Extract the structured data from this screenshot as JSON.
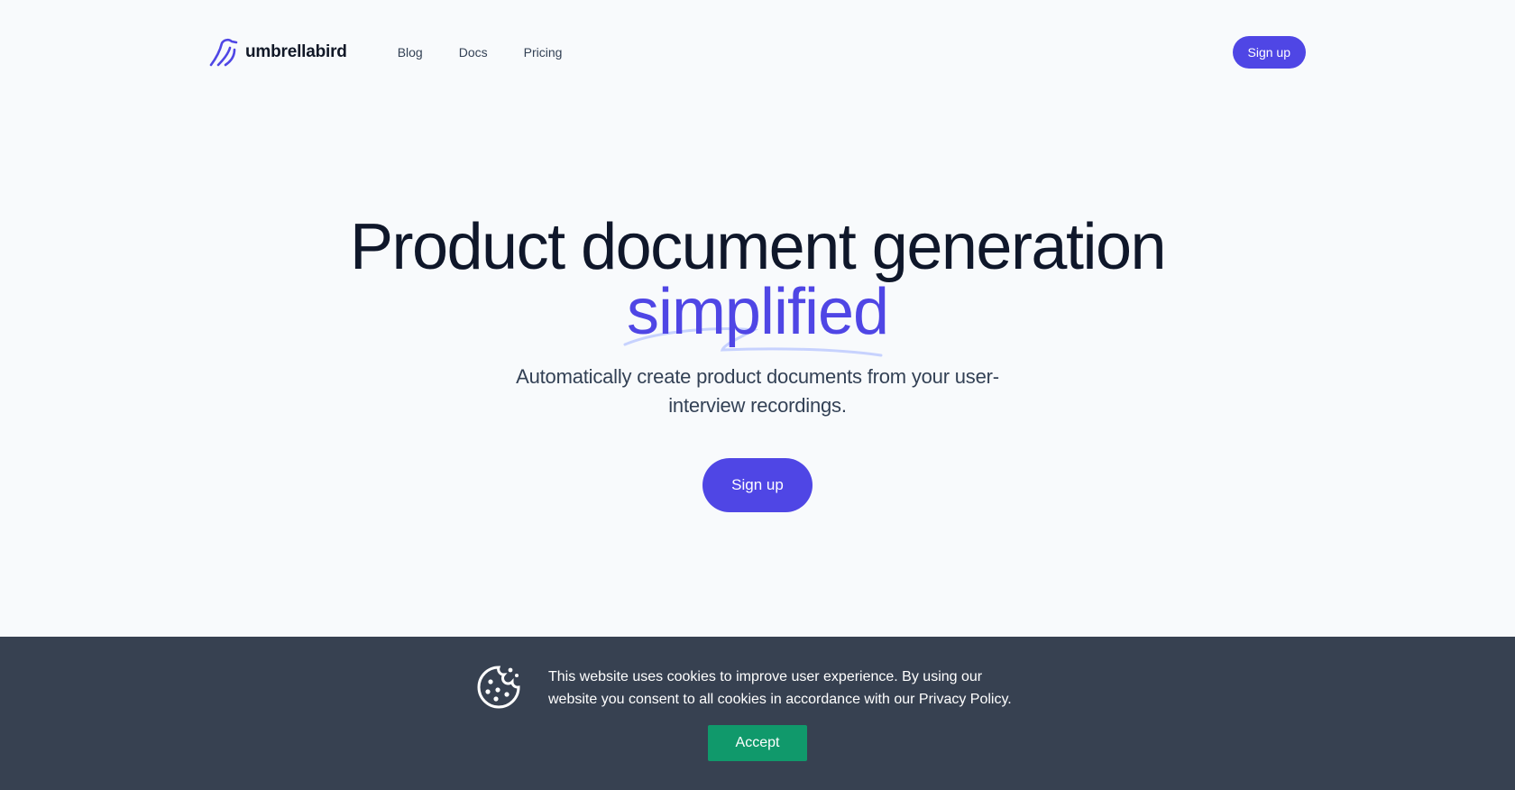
{
  "brand": {
    "name": "umbrellabird",
    "accent": "#4f46e5",
    "cookie_bg": "#374151",
    "accept_bg": "#10996b"
  },
  "nav": {
    "items": [
      {
        "label": "Blog"
      },
      {
        "label": "Docs"
      },
      {
        "label": "Pricing"
      }
    ]
  },
  "header": {
    "signup_label": "Sign up"
  },
  "hero": {
    "title": "Product document generation",
    "accent": "simplified",
    "subtitle": "Automatically create product documents from your user-interview recordings.",
    "signup_label": "Sign up"
  },
  "cookie": {
    "icon": "cookie-icon",
    "message": "This website uses cookies to improve user experience. By using our website you consent to all cookies in accordance with our Privacy Policy.",
    "accept_label": "Accept"
  }
}
